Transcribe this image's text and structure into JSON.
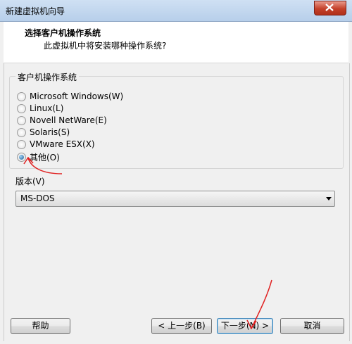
{
  "window": {
    "title": "新建虚拟机向导"
  },
  "header": {
    "title": "选择客户机操作系统",
    "subtitle": "此虚拟机中将安装哪种操作系统?"
  },
  "guest_os": {
    "group_label": "客户机操作系统",
    "options": [
      {
        "label": "Microsoft Windows(W)",
        "selected": false
      },
      {
        "label": "Linux(L)",
        "selected": false
      },
      {
        "label": "Novell NetWare(E)",
        "selected": false
      },
      {
        "label": "Solaris(S)",
        "selected": false
      },
      {
        "label": "VMware ESX(X)",
        "selected": false
      },
      {
        "label": "其他(O)",
        "selected": true
      }
    ]
  },
  "version": {
    "label": "版本(V)",
    "selected": "MS-DOS"
  },
  "buttons": {
    "help": "帮助",
    "back": "< 上一步(B)",
    "next": "下一步(N) >",
    "cancel": "取消"
  },
  "colors": {
    "annotation": "#e02020"
  }
}
